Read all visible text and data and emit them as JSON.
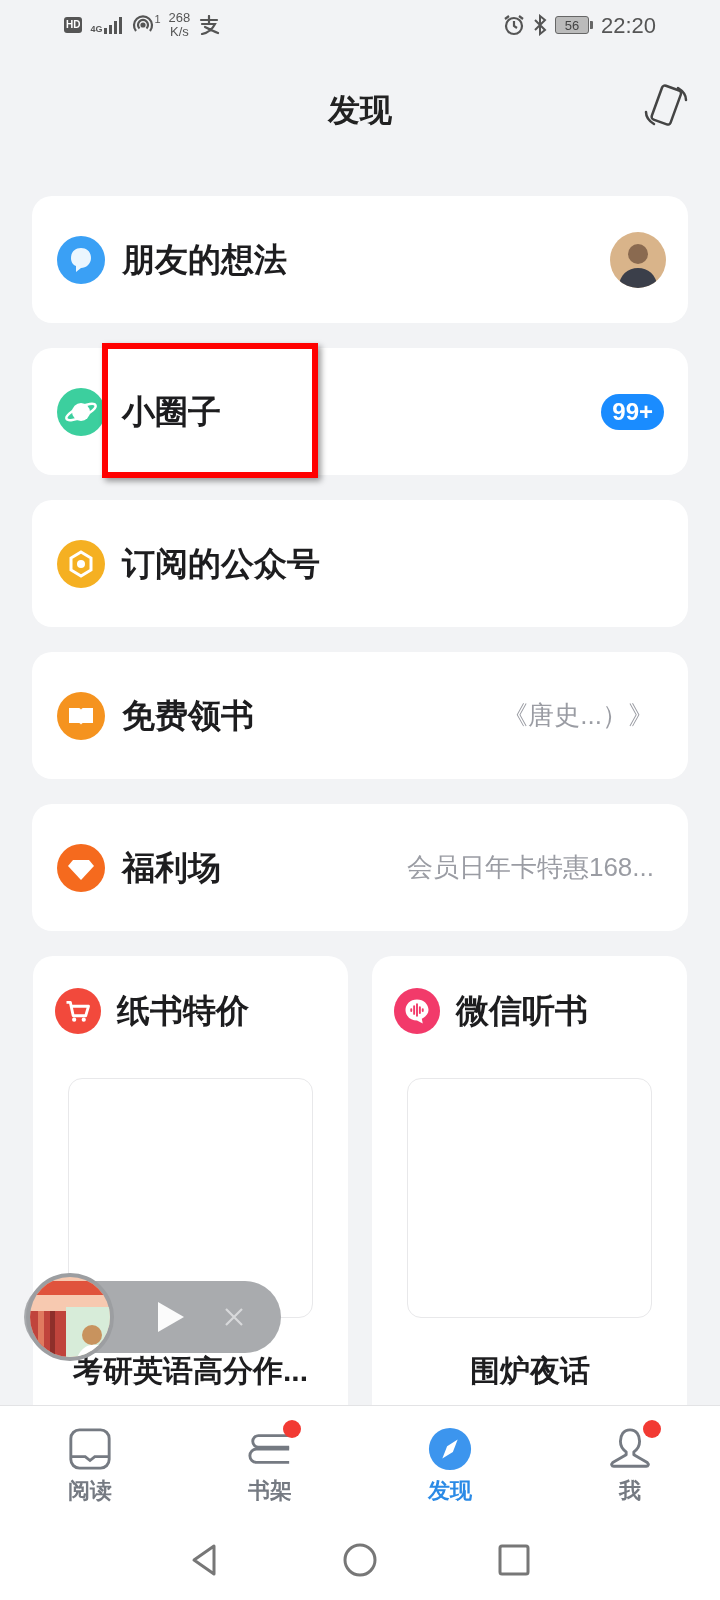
{
  "status_bar": {
    "hd": "HD",
    "network": "4G",
    "hotspot_count": "1",
    "speed_value": "268",
    "speed_unit": "K/s",
    "battery": "56",
    "time": "22:20"
  },
  "header": {
    "title": "发现"
  },
  "rows": [
    {
      "kind": "thoughts",
      "label": "朋友的想法",
      "trailing": {
        "kind": "avatar"
      },
      "highlighted": false
    },
    {
      "kind": "circle",
      "label": "小圈子",
      "trailing": {
        "kind": "badge",
        "text": "99+"
      },
      "highlighted": true
    },
    {
      "kind": "subscriptions",
      "label": "订阅的公众号",
      "highlighted": false
    },
    {
      "kind": "freebook",
      "label": "免费领书",
      "trailing": {
        "kind": "text",
        "text": "《唐史...）》"
      },
      "highlighted": false
    },
    {
      "kind": "welfare",
      "label": "福利场",
      "trailing": {
        "kind": "text",
        "text": "会员日年卡特惠168..."
      },
      "highlighted": false
    }
  ],
  "tiles": [
    {
      "kind": "cart",
      "title": "纸书特价",
      "caption": "考研英语高分作..."
    },
    {
      "kind": "audio",
      "title": "微信听书",
      "caption": "围炉夜话"
    }
  ],
  "tabs": [
    {
      "kind": "read",
      "label": "阅读",
      "selected": false,
      "dot": false
    },
    {
      "kind": "shelf",
      "label": "书架",
      "selected": false,
      "dot": true
    },
    {
      "kind": "discover",
      "label": "发现",
      "selected": true,
      "dot": false
    },
    {
      "kind": "me",
      "label": "我",
      "selected": false,
      "dot": true
    }
  ]
}
